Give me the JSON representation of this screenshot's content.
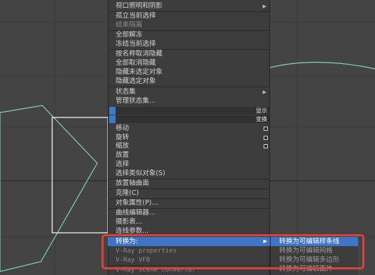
{
  "menu": {
    "items": [
      {
        "label": "视口照明和阴影",
        "state": "enabled",
        "submenu": true
      },
      {
        "label": "孤立当前选择",
        "state": "enabled"
      },
      {
        "label": "结束隔离",
        "state": "disabled"
      },
      {
        "label": "全部解冻",
        "state": "enabled"
      },
      {
        "label": "冻结当前选择",
        "state": "enabled"
      },
      {
        "label": "按名称取消隐藏",
        "state": "enabled"
      },
      {
        "label": "全部取消隐藏",
        "state": "enabled"
      },
      {
        "label": "隐藏未选定对象",
        "state": "enabled"
      },
      {
        "label": "隐藏选定对象",
        "state": "enabled"
      },
      {
        "label": "状态集",
        "state": "enabled",
        "submenu": true
      },
      {
        "label": "管理状态集...",
        "state": "enabled"
      },
      {
        "label": "移动",
        "state": "enabled",
        "checkbox": true
      },
      {
        "label": "旋转",
        "state": "enabled",
        "checkbox": true
      },
      {
        "label": "缩放",
        "state": "enabled",
        "checkbox": true
      },
      {
        "label": "放置",
        "state": "enabled"
      },
      {
        "label": "选择",
        "state": "enabled"
      },
      {
        "label": "选择类似对象(S)",
        "state": "enabled"
      },
      {
        "label": "放置轴曲面",
        "state": "enabled"
      },
      {
        "label": "克隆(C)",
        "state": "enabled"
      },
      {
        "label": "对象属性(P)...",
        "state": "enabled"
      },
      {
        "label": "曲线编辑器...",
        "state": "enabled"
      },
      {
        "label": "摄影表...",
        "state": "enabled"
      },
      {
        "label": "连线参数...",
        "state": "enabled"
      },
      {
        "label": "转换为:",
        "state": "highlighted",
        "submenu": true
      },
      {
        "label": "V-Ray properties",
        "state": "disabled"
      },
      {
        "label": "V-Ray VFB",
        "state": "disabled"
      },
      {
        "label": "V-Ray scene converter",
        "state": "disabled"
      }
    ],
    "sections": {
      "display": "显示",
      "transform": "变换"
    }
  },
  "submenu": {
    "items": [
      {
        "label": "转换为可编辑样条线",
        "state": "highlighted"
      },
      {
        "label": "转换为可编辑网格",
        "state": "disabled"
      },
      {
        "label": "转换为可编辑多边形",
        "state": "disabled"
      },
      {
        "label": "转换为可编辑面片",
        "state": "disabled"
      }
    ]
  },
  "colors": {
    "viewport_bg": "#444444",
    "menu_bg": "#3c3c3c",
    "highlight": "#3f75c6",
    "annotation_box": "#d8443c",
    "spline": "#7fd6a8"
  }
}
